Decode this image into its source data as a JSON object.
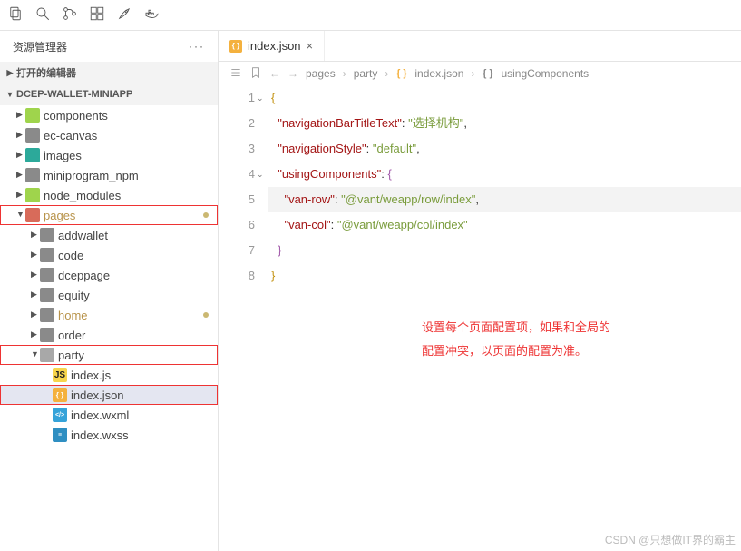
{
  "titlebar": {
    "icons": [
      "files",
      "search",
      "scm",
      "debug",
      "extensions",
      "docker"
    ]
  },
  "explorer": {
    "title": "资源管理器",
    "sections": {
      "opened": "打开的编辑器",
      "project": "DCEP-WALLET-MINIAPP"
    }
  },
  "tree": {
    "components": "components",
    "ec_canvas": "ec-canvas",
    "images": "images",
    "miniprogram_npm": "miniprogram_npm",
    "node_modules": "node_modules",
    "pages": "pages",
    "addwallet": "addwallet",
    "code": "code",
    "dceppage": "dceppage",
    "equity": "equity",
    "home": "home",
    "order": "order",
    "party": "party",
    "index_js": "index.js",
    "index_json": "index.json",
    "index_wxml": "index.wxml",
    "index_wxss": "index.wxss"
  },
  "tab": {
    "label": "index.json"
  },
  "breadcrumb": {
    "p1": "pages",
    "p2": "party",
    "p3": "index.json",
    "p4": "usingComponents"
  },
  "code": {
    "keys": {
      "navTitle": "\"navigationBarTitleText\"",
      "navStyle": "\"navigationStyle\"",
      "usingComponents": "\"usingComponents\"",
      "vanRow": "\"van-row\"",
      "vanCol": "\"van-col\""
    },
    "vals": {
      "navTitle": "\"选择机构\"",
      "navStyle": "\"default\"",
      "vanRow": "\"@vant/weapp/row/index\"",
      "vanCol": "\"@vant/weapp/col/index\""
    },
    "annotation_l1": "设置每个页面配置项，如果和全局的",
    "annotation_l2": "配置冲突，以页面的配置为准。"
  },
  "watermark": "CSDN @只想做IT界的霸主"
}
